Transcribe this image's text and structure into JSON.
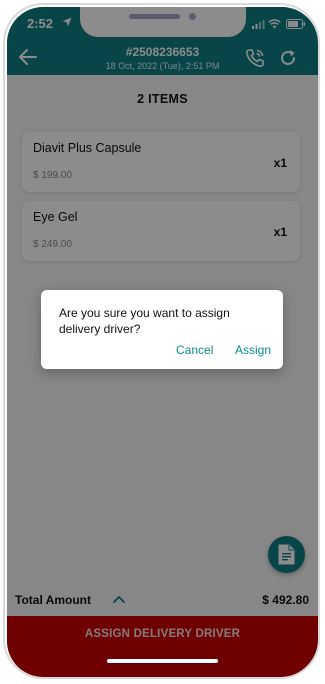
{
  "status": {
    "time": "2:52"
  },
  "header": {
    "order_number": "#2508236653",
    "order_date": "18 Oct, 2022 (Tue),  2:51 PM"
  },
  "items_count": "2 ITEMS",
  "items": [
    {
      "name": "Diavit Plus Capsule",
      "price": "$ 199.00",
      "qty": "x1"
    },
    {
      "name": "Eye Gel",
      "price": "$ 249.00",
      "qty": "x1"
    }
  ],
  "total": {
    "label": "Total Amount",
    "value": "$ 492.80"
  },
  "assign_button": {
    "label": "ASSIGN DELIVERY DRIVER"
  },
  "dialog": {
    "message": "Are you sure you want to assign delivery driver?",
    "cancel_label": "Cancel",
    "confirm_label": "Assign"
  },
  "colors": {
    "header": "#0e7f84",
    "assign_bar": "#c80000",
    "dialog_action": "#0e8a91"
  },
  "icons": [
    "location-arrow-icon",
    "signal-icon",
    "wifi-icon",
    "battery-icon",
    "back-arrow-icon",
    "phone-icon",
    "refresh-icon",
    "chevron-up-icon",
    "document-icon"
  ]
}
